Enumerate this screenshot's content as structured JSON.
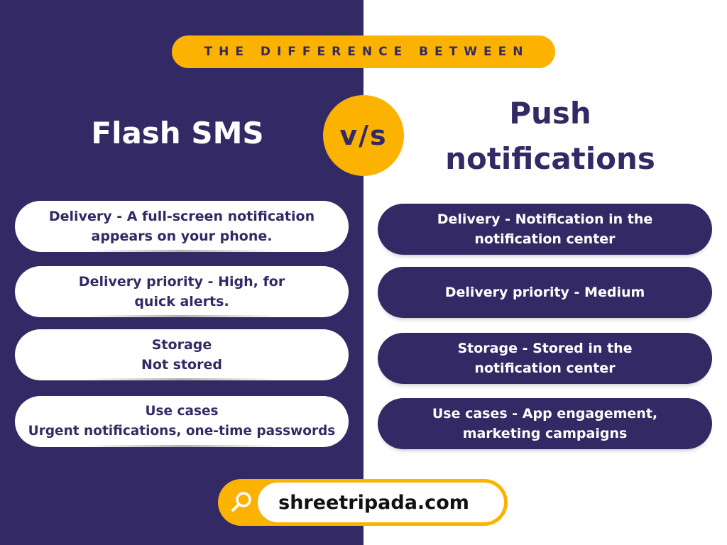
{
  "banner": {
    "text": "THE DIFFERENCE BETWEEN"
  },
  "vs": {
    "text": "v/s"
  },
  "left": {
    "title": "Flash SMS",
    "cards": [
      {
        "text": "Delivery - A full-screen notification\nappears on your phone."
      },
      {
        "text": "Delivery priority - High, for\nquick alerts."
      },
      {
        "text": "Storage\nNot stored"
      },
      {
        "text": "Use cases\nUrgent notifications, one-time passwords"
      }
    ]
  },
  "right": {
    "title": "Push\nnotifications",
    "cards": [
      {
        "text": "Delivery - Notification in the\nnotification center"
      },
      {
        "text": "Delivery priority - Medium"
      },
      {
        "text": "Storage - Stored in the\nnotification center"
      },
      {
        "text": "Use cases - App engagement,\nmarketing campaigns"
      }
    ]
  },
  "footer": {
    "url": "shreetripada.com",
    "icon": "search-icon"
  },
  "colors": {
    "navy": "#332a65",
    "amber": "#fcb200",
    "white": "#ffffff"
  }
}
